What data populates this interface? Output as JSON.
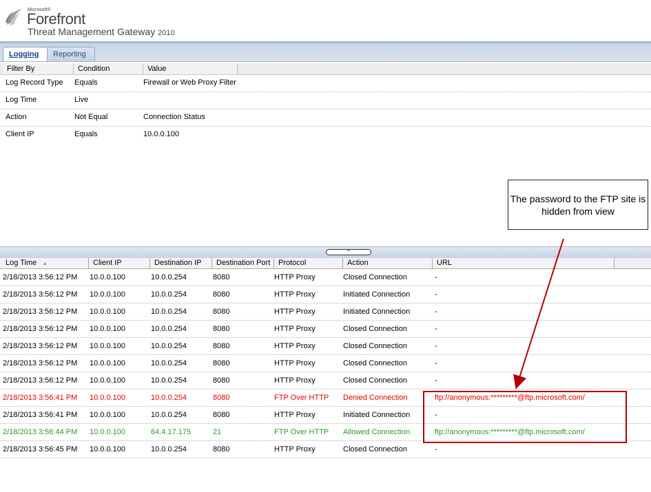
{
  "brand": {
    "company": "Microsoft®",
    "product": "Forefront",
    "subtitle": "Threat Management Gateway",
    "year": "2010"
  },
  "tabs": [
    {
      "label": "Logging",
      "active": true
    },
    {
      "label": "Reporting",
      "active": false
    }
  ],
  "filter": {
    "headers": [
      "Filter By",
      "Condition",
      "Value"
    ],
    "rows": [
      {
        "filter_by": "Log Record Type",
        "condition": "Equals",
        "value": "Firewall or Web Proxy Filter"
      },
      {
        "filter_by": "Log Time",
        "condition": "Live",
        "value": ""
      },
      {
        "filter_by": "Action",
        "condition": "Not Equal",
        "value": "Connection Status"
      },
      {
        "filter_by": "Client IP",
        "condition": "Equals",
        "value": "10.0.0.100"
      }
    ]
  },
  "callout": {
    "text": "The password to the FTP site is hidden from view"
  },
  "log": {
    "headers": [
      "Log Time",
      "Client IP",
      "Destination IP",
      "Destination Port",
      "Protocol",
      "Action",
      "URL"
    ],
    "sorted_column": "Log Time",
    "rows": [
      {
        "time": "2/18/2013 3:56:12 PM",
        "client_ip": "10.0.0.100",
        "dest_ip": "10.0.0.254",
        "dest_port": "8080",
        "protocol": "HTTP Proxy",
        "action": "Closed Connection",
        "url": "-",
        "status": "normal"
      },
      {
        "time": "2/18/2013 3:56:12 PM",
        "client_ip": "10.0.0.100",
        "dest_ip": "10.0.0.254",
        "dest_port": "8080",
        "protocol": "HTTP Proxy",
        "action": "Initiated Connection",
        "url": "-",
        "status": "normal"
      },
      {
        "time": "2/18/2013 3:56:12 PM",
        "client_ip": "10.0.0.100",
        "dest_ip": "10.0.0.254",
        "dest_port": "8080",
        "protocol": "HTTP Proxy",
        "action": "Initiated Connection",
        "url": "-",
        "status": "normal"
      },
      {
        "time": "2/18/2013 3:56:12 PM",
        "client_ip": "10.0.0.100",
        "dest_ip": "10.0.0.254",
        "dest_port": "8080",
        "protocol": "HTTP Proxy",
        "action": "Closed Connection",
        "url": "-",
        "status": "normal"
      },
      {
        "time": "2/18/2013 3:56:12 PM",
        "client_ip": "10.0.0.100",
        "dest_ip": "10.0.0.254",
        "dest_port": "8080",
        "protocol": "HTTP Proxy",
        "action": "Closed Connection",
        "url": "-",
        "status": "normal"
      },
      {
        "time": "2/18/2013 3:56:12 PM",
        "client_ip": "10.0.0.100",
        "dest_ip": "10.0.0.254",
        "dest_port": "8080",
        "protocol": "HTTP Proxy",
        "action": "Closed Connection",
        "url": "-",
        "status": "normal"
      },
      {
        "time": "2/18/2013 3:56:12 PM",
        "client_ip": "10.0.0.100",
        "dest_ip": "10.0.0.254",
        "dest_port": "8080",
        "protocol": "HTTP Proxy",
        "action": "Closed Connection",
        "url": "-",
        "status": "normal"
      },
      {
        "time": "2/18/2013 3:56:41 PM",
        "client_ip": "10.0.0.100",
        "dest_ip": "10.0.0.254",
        "dest_port": "8080",
        "protocol": "FTP Over HTTP",
        "action": "Denied Connection",
        "url": "ftp://anonymous:*********@ftp.microsoft.com/",
        "status": "denied"
      },
      {
        "time": "2/18/2013 3:56:41 PM",
        "client_ip": "10.0.0.100",
        "dest_ip": "10.0.0.254",
        "dest_port": "8080",
        "protocol": "HTTP Proxy",
        "action": "Initiated Connection",
        "url": "-",
        "status": "normal"
      },
      {
        "time": "2/18/2013 3:56:44 PM",
        "client_ip": "10.0.0.100",
        "dest_ip": "64.4.17.175",
        "dest_port": "21",
        "protocol": "FTP Over HTTP",
        "action": "Allowed Connection",
        "url": "ftp://anonymous:*********@ftp.microsoft.com/",
        "status": "allowed"
      },
      {
        "time": "2/18/2013 3:56:45 PM",
        "client_ip": "10.0.0.100",
        "dest_ip": "10.0.0.254",
        "dest_port": "8080",
        "protocol": "HTTP Proxy",
        "action": "Closed Connection",
        "url": "-",
        "status": "normal"
      }
    ]
  },
  "colors": {
    "denied": "#e00000",
    "allowed": "#2a9a2a",
    "annotation": "#b40000"
  },
  "icons": {
    "logo": "forefront-logo-icon",
    "sort": "sort-ascending-icon",
    "splitter": "chevron-up-icon"
  }
}
